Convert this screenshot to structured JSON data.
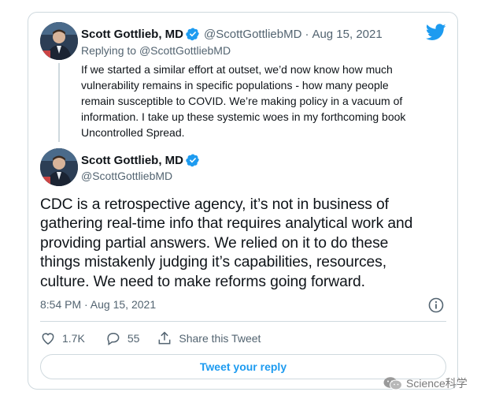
{
  "reply_tweet": {
    "author_name": "Scott Gottlieb, MD",
    "handle": "@ScottGottliebMD",
    "separator": "·",
    "date": "Aug 15, 2021",
    "replying_label": "Replying to",
    "replying_to": "@ScottGottliebMD",
    "text": "If we started a similar effort at outset, we’d now know how much\nvulnerability remains in specific populations - how many people\nremain susceptible to COVID. We’re making policy in a vacuum of\ninformation. I take up these systemic woes in my forthcoming book\nUncontrolled Spread."
  },
  "main_tweet": {
    "author_name": "Scott Gottlieb, MD",
    "handle": "@ScottGottliebMD",
    "text": "CDC is a retrospective agency, it’s not in business of\ngathering real-time info that requires analytical work and\nproviding partial answers. We relied on it to do these\nthings mistakenly judging it’s capabilities, resources,\nculture. We need to make reforms going forward.",
    "timestamp": "8:54 PM · Aug 15, 2021"
  },
  "actions": {
    "like_count": "1.7K",
    "reply_count": "55",
    "share_label": "Share this Tweet"
  },
  "reply_button_label": "Tweet your reply",
  "watermark_text": "Science科学",
  "icons": {
    "brand": "twitter-bird-icon",
    "verified": "verified-badge-icon",
    "info": "info-icon",
    "like": "heart-icon",
    "reply": "comment-icon",
    "share": "share-icon"
  },
  "colors": {
    "accent": "#1d9bf0",
    "text": "#0f1419",
    "muted": "#536471",
    "border": "#cfd9de"
  }
}
